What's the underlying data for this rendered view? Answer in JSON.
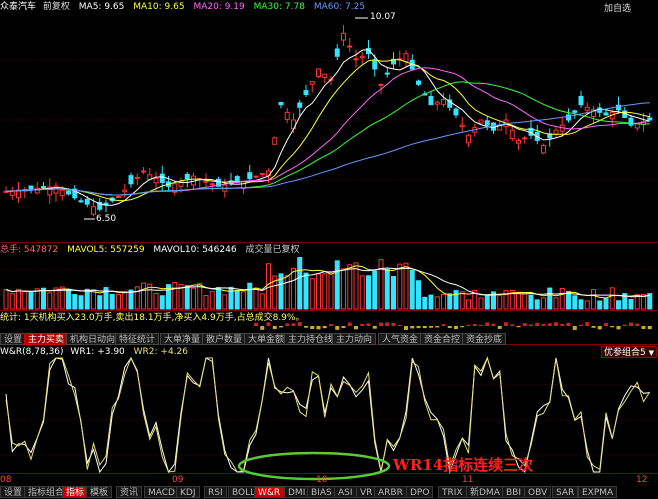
{
  "kline": {
    "header": {
      "title": "众泰汽车",
      "sub": "前复权",
      "ma5": "MA5: 9.65",
      "ma10": "MA10: 9.65",
      "ma20": "MA20: 9.19",
      "ma30": "MA30: 7.78",
      "ma60": "MA60: 7.25"
    },
    "high_label": "10.07",
    "low_label": "6.50",
    "right_label": "加自选"
  },
  "volume": {
    "total": "总手: 547872",
    "mavol5": "MAVOL5: 557259",
    "mavol10": "MAVOL10: 546246",
    "note": "成交量已复权"
  },
  "flow": {
    "text": "统计: 1天机构买入23.0万手,卖出18.1万手,净买入4.9万手,占总成交8.9%。"
  },
  "indicator_tabs": [
    {
      "label": "设置",
      "active": false
    },
    {
      "label": "主力买卖",
      "active": true
    },
    {
      "label": "机构日动向",
      "active": false
    },
    {
      "label": "特征统计",
      "active": false
    },
    {
      "label": "大单净量",
      "active": false
    },
    {
      "label": "散户数量",
      "active": false
    },
    {
      "label": "大单金额",
      "active": false
    },
    {
      "label": "主力持仓线",
      "active": false
    },
    {
      "label": "主力动向",
      "active": false
    },
    {
      "label": "人气资金",
      "active": false
    },
    {
      "label": "资金合控",
      "active": false
    },
    {
      "label": "资金抄底",
      "active": false
    }
  ],
  "wr": {
    "name": "W&R(8,78,36)",
    "wr1": "WR1: +3.90",
    "wr2": "WR2: +4.26",
    "dropdown": "优参组合5",
    "annotation": "WR14指标连续三次"
  },
  "axis_dates": [
    "08",
    "09",
    "10",
    "11",
    "12"
  ],
  "bottom_tabs": [
    {
      "label": "设置",
      "active": false
    },
    {
      "label": "指标组合",
      "active": false
    },
    {
      "label": "指标",
      "active": true
    },
    {
      "label": "模板",
      "active": false
    },
    {
      "label": "资讯",
      "active": false
    },
    {
      "label": "MACD",
      "active": false
    },
    {
      "label": "KDJ",
      "active": false
    },
    {
      "label": "RSI",
      "active": false
    },
    {
      "label": "BOLL",
      "active": false
    },
    {
      "label": "W&R",
      "active": true
    },
    {
      "label": "DMI",
      "active": false
    },
    {
      "label": "BIAS",
      "active": false
    },
    {
      "label": "ASI",
      "active": false
    },
    {
      "label": "VR",
      "active": false
    },
    {
      "label": "ARBR",
      "active": false
    },
    {
      "label": "DPO",
      "active": false
    },
    {
      "label": "TRIX",
      "active": false
    },
    {
      "label": "新DMA",
      "active": false
    },
    {
      "label": "BBI",
      "active": false
    },
    {
      "label": "OBV",
      "active": false
    },
    {
      "label": "SAR",
      "active": false
    },
    {
      "label": "EXPMA",
      "active": false
    }
  ],
  "colors": {
    "up": "#ff3333",
    "down": "#33e5ff",
    "ma5": "#ffffff",
    "ma10": "#ffff33",
    "ma20": "#ff66ff",
    "ma30": "#33ff33",
    "ma60": "#6699ff",
    "wr1": "#ffffff",
    "wr2": "#e8e070",
    "ellipse": "#5fc83a",
    "annotation": "#ff2020"
  }
}
